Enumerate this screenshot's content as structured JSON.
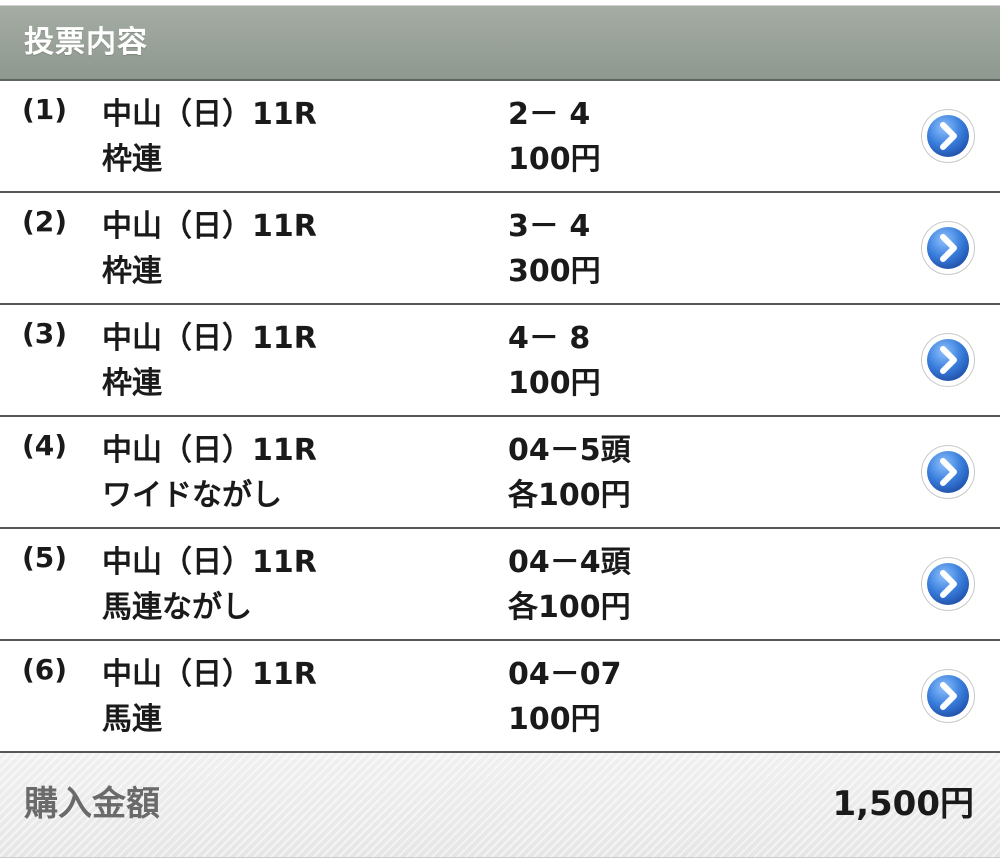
{
  "header": {
    "title": "投票内容"
  },
  "bets": [
    {
      "num": "(1)",
      "race": "中山（日）11R",
      "type": "枠連",
      "combo": "2－ 4",
      "amount": "100円"
    },
    {
      "num": "(2)",
      "race": "中山（日）11R",
      "type": "枠連",
      "combo": "3－ 4",
      "amount": "300円"
    },
    {
      "num": "(3)",
      "race": "中山（日）11R",
      "type": "枠連",
      "combo": "4－ 8",
      "amount": "100円"
    },
    {
      "num": "(4)",
      "race": "中山（日）11R",
      "type": "ワイドながし",
      "combo": "04－5頭",
      "amount": "各100円"
    },
    {
      "num": "(5)",
      "race": "中山（日）11R",
      "type": "馬連ながし",
      "combo": "04－4頭",
      "amount": "各100円"
    },
    {
      "num": "(6)",
      "race": "中山（日）11R",
      "type": "馬連",
      "combo": "04－07",
      "amount": "100円"
    }
  ],
  "total": {
    "label": "購入金額",
    "value": "1,500円"
  },
  "icons": {
    "row_action": "chevron-right-circle-icon"
  },
  "colors": {
    "header_bg": "#969f96",
    "arrow_blue": "#2f6fd0",
    "total_label": "#6a6a6a"
  }
}
